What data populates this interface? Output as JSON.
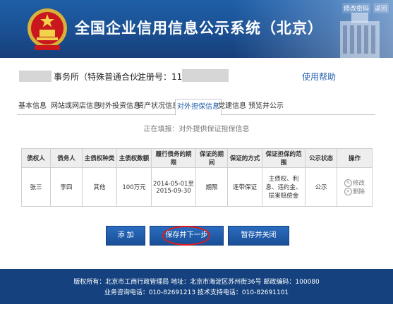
{
  "header": {
    "title": "全国企业信用信息公示系统（北京）",
    "links": [
      "修改密码",
      "返回"
    ]
  },
  "info": {
    "firm_suffix": "事务所（特殊普通合伙）",
    "reg_label": "注册号：1100",
    "help": "使用帮助"
  },
  "tabs": [
    "基本信息",
    "网站或网店信息",
    "对外投资信息",
    "资产状况信息",
    "对外担保信息",
    "党建信息",
    "预览并公示"
  ],
  "subtitle": "正在填报：对外提供保证担保信息",
  "table": {
    "headers": [
      "债权人",
      "债务人",
      "主债权种类",
      "主债权数额",
      "履行债务的期限",
      "保证的期间",
      "保证的方式",
      "保证担保的范围",
      "公示状态",
      "操作"
    ],
    "row": {
      "creditor": "张三",
      "debtor": "李四",
      "type": "其他",
      "amount": "100万元",
      "term_start": "2014-05-01至",
      "term_end": "2015-09-30",
      "period": "期限",
      "method": "连带保证",
      "scope": "主债权、利息、违约金、损害赔偿金",
      "status": "公示",
      "edit": "修改",
      "delete": "删除"
    }
  },
  "buttons": {
    "add": "添 加",
    "save_next": "保存并下一步",
    "save_close": "暂存并关闭"
  },
  "footer": {
    "line1": "版权所有：北京市工商行政管理局    地址：北京市海淀区苏州街36号    邮政编码：100080",
    "line2": "业务咨询电话：010-82691213    技术支持电话：010-82691101"
  }
}
